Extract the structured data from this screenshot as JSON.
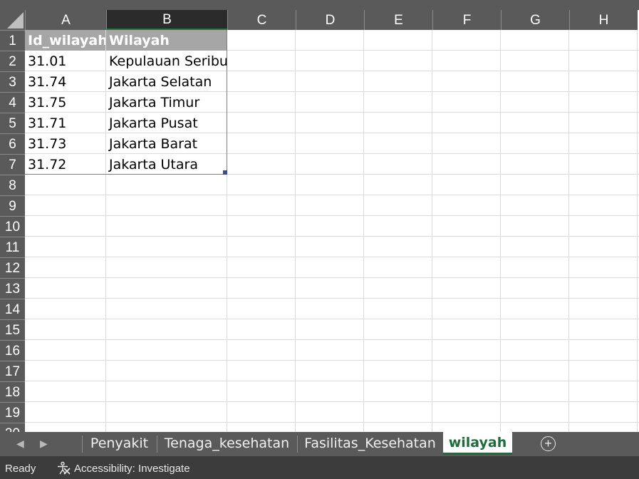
{
  "columns": [
    "A",
    "B",
    "C",
    "D",
    "E",
    "F",
    "G",
    "H"
  ],
  "rows": [
    "1",
    "2",
    "3",
    "4",
    "5",
    "6",
    "7",
    "8",
    "9",
    "10",
    "11",
    "12",
    "13",
    "14",
    "15",
    "16",
    "17",
    "18",
    "19",
    "20"
  ],
  "table": {
    "headers": [
      "Id_wilayah",
      "Wilayah"
    ],
    "rows": [
      [
        "31.01",
        "Kepulauan Seribu"
      ],
      [
        "31.74",
        "Jakarta Selatan"
      ],
      [
        "31.75",
        "Jakarta Timur"
      ],
      [
        "31.71",
        "Jakarta Pusat"
      ],
      [
        "31.73",
        "Jakarta Barat"
      ],
      [
        "31.72",
        "Jakarta Utara"
      ]
    ]
  },
  "sheet_tabs": [
    "Penyakit",
    "Tenaga_kesehatan",
    "Fasilitas_Kesehatan",
    "wilayah"
  ],
  "active_tab": "wilayah",
  "status": {
    "ready": "Ready",
    "accessibility": "Accessibility: Investigate"
  },
  "colors": {
    "accent": "#1e6b3c",
    "header_bg": "#5a5a5a",
    "table_header_bg": "#a6a6a6"
  },
  "icons": [
    "select-all-triangle-icon",
    "scroll-left-icon",
    "scroll-right-icon",
    "add-sheet-icon",
    "accessibility-icon"
  ]
}
